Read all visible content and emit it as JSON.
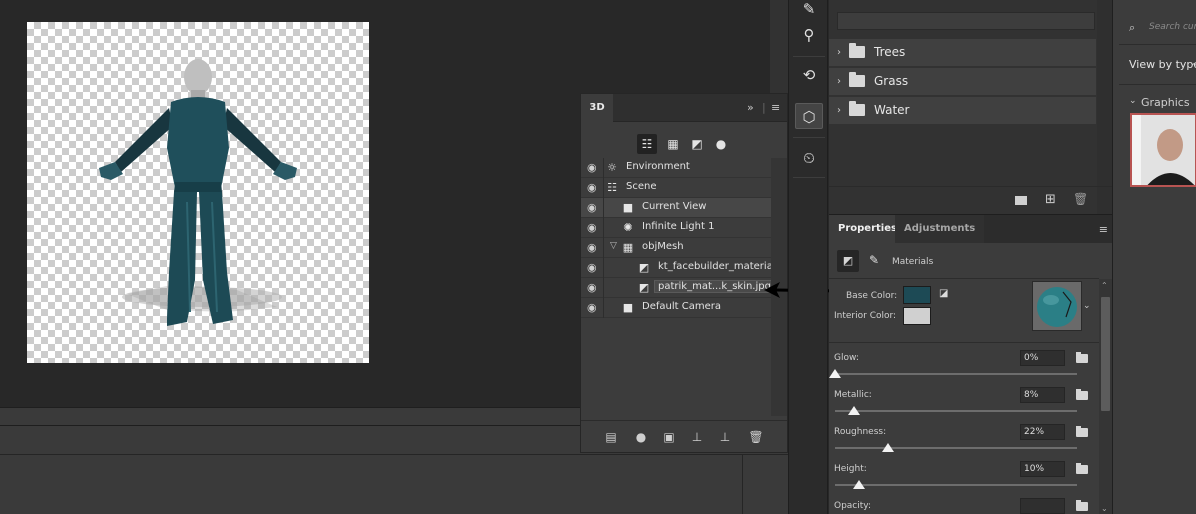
{
  "panel_3d": {
    "tab_label": "3D",
    "scene_items": [
      {
        "label": "Environment"
      },
      {
        "label": "Scene"
      },
      {
        "label": "Current View"
      },
      {
        "label": "Infinite Light 1"
      },
      {
        "label": "objMesh"
      },
      {
        "label": "kt_facebuilder_material"
      },
      {
        "label": "patrik_mat...k_skin.jpg"
      },
      {
        "label": "Default Camera"
      }
    ]
  },
  "library": {
    "folders": [
      {
        "label": "Trees"
      },
      {
        "label": "Grass"
      },
      {
        "label": "Water"
      }
    ],
    "search_placeholder": "Search cur",
    "view_by": "View by type",
    "section": "Graphics"
  },
  "properties": {
    "tabs": {
      "properties": "Properties",
      "adjustments": "Adjustments"
    },
    "mode_label": "Materials",
    "base_color_label": "Base Color:",
    "interior_color_label": "Interior Color:",
    "base_color": "#1d4a55",
    "interior_color": "#d0d0d0",
    "sliders": [
      {
        "label": "Glow:",
        "value_text": "0%",
        "value": 0
      },
      {
        "label": "Metallic:",
        "value_text": "8%",
        "value": 8
      },
      {
        "label": "Roughness:",
        "value_text": "22%",
        "value": 22
      },
      {
        "label": "Height:",
        "value_text": "10%",
        "value": 10
      },
      {
        "label": "Opacity:",
        "value_text": "",
        "value": null
      }
    ]
  },
  "colors": {
    "model_teal": "#1d4a55",
    "annotation_arrow": "#000000"
  }
}
